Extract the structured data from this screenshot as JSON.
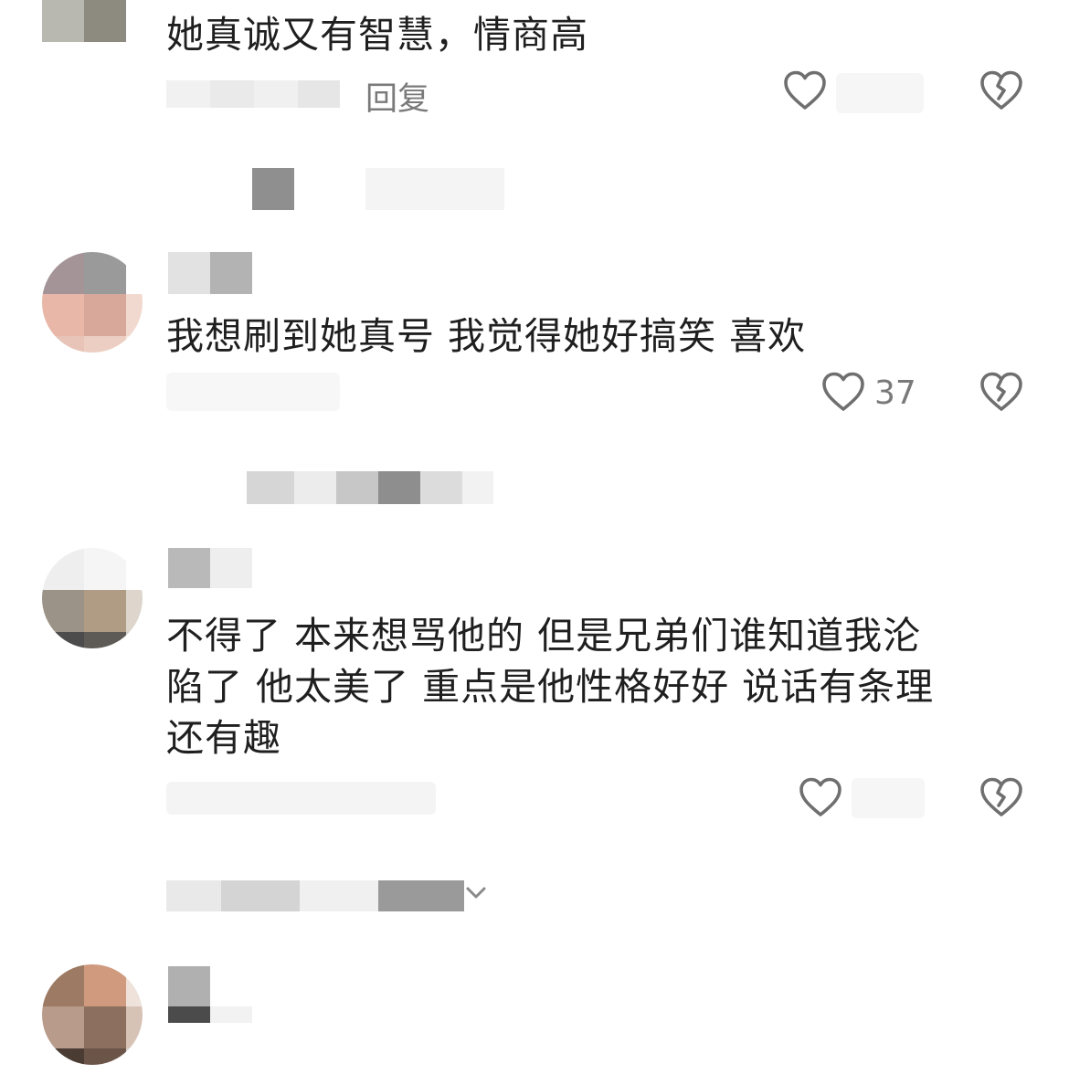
{
  "comments": [
    {
      "text_lines": [
        "她真诚又有智慧，情商高"
      ],
      "reply_label": "回复"
    },
    {
      "text_lines": [
        "我想刷到她真号  我觉得她好搞笑 喜欢"
      ],
      "like_count": "37"
    },
    {
      "text_lines": [
        "不得了  本来想骂他的   但是兄弟们谁知道我沦",
        "陷了  他太美了  重点是他性格好好  说话有条理",
        "还有趣"
      ]
    }
  ],
  "icons": {
    "like": "heart-outline-icon",
    "dislike": "broken-heart-icon",
    "expand": "chevron-down-icon"
  },
  "colors": {
    "text": "#1f1f1f",
    "secondary": "#7a7a7a",
    "icon": "#6f6f6f"
  }
}
